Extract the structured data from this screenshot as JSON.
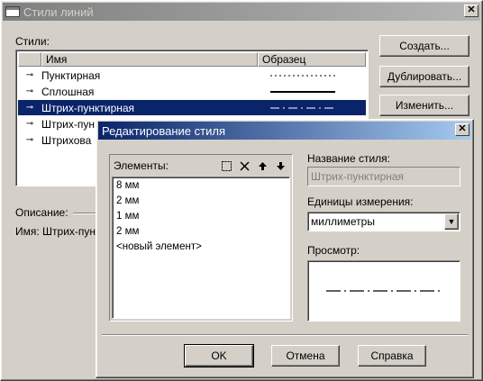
{
  "main_window": {
    "title": "Стили линий",
    "close": "✕",
    "styles_label": "Стили:",
    "columns": {
      "name": "Имя",
      "sample": "Образец"
    },
    "rows": [
      {
        "name": "Пунктирная",
        "pattern": "dotted"
      },
      {
        "name": "Сплошная",
        "pattern": "solid"
      },
      {
        "name": "Штрих-пунктирная",
        "pattern": "dashdot",
        "selected": true
      },
      {
        "name": "Штрих-пун"
      },
      {
        "name": "Штрихова"
      }
    ],
    "buttons": {
      "create": "Создать...",
      "duplicate": "Дублировать...",
      "edit": "Изменить..."
    },
    "description_label": "Описание:",
    "name_label": "Имя: Штрих-пун"
  },
  "dialog": {
    "title": "Редактирование стиля",
    "close": "✕",
    "elements_label": "Элементы:",
    "elements": [
      "8 мм",
      "2 мм",
      "1 мм",
      "2 мм",
      "<новый элемент>"
    ],
    "style_name_label": "Название стиля:",
    "style_name_value": "Штрих-пунктирная",
    "units_label": "Единицы измерения:",
    "units_value": "миллиметры",
    "preview_label": "Просмотр:",
    "buttons": {
      "ok": "OK",
      "cancel": "Отмена",
      "help": "Справка"
    },
    "toolbar_icons": [
      "new-element-icon",
      "delete-icon",
      "move-up-icon",
      "move-down-icon"
    ]
  }
}
